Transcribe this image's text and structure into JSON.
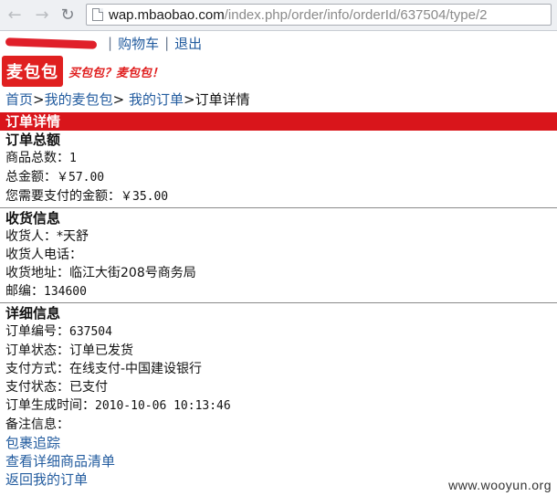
{
  "browser": {
    "url_host": "wap.mbaobao.com",
    "url_path": "/index.php/order/info/orderId/637504/type/2"
  },
  "userbar": {
    "cart_label": "购物车",
    "logout_label": "退出",
    "separator": "|"
  },
  "brand": {
    "logo_text": "麦包包",
    "slogan": "买包包？麦包包！",
    "accent_color": "#d9151b"
  },
  "breadcrumb": {
    "home": "首页",
    "my_bag": "我的麦包包",
    "my_orders": "我的订单",
    "current": "订单详情",
    "sep": ">"
  },
  "page_title": "订单详情",
  "order_total": {
    "heading": "订单总额",
    "item_count_label": "商品总数：",
    "item_count": "1",
    "total_label": "总金额：",
    "total": "￥57.00",
    "due_label": "您需要支付的金额：",
    "due": "￥35.00"
  },
  "shipping": {
    "heading": "收货信息",
    "receiver_label": "收货人：",
    "receiver": "*天舒",
    "phone_label": "收货人电话：",
    "phone": "",
    "address_label": "收货地址：",
    "address": "临江大街208号商务局",
    "zip_label": "邮编：",
    "zip": "134600"
  },
  "details": {
    "heading": "详细信息",
    "order_no_label": "订单编号：",
    "order_no": "637504",
    "status_label": "订单状态：",
    "status": "订单已发货",
    "pay_method_label": "支付方式：",
    "pay_method": "在线支付-中国建设银行",
    "pay_status_label": "支付状态：",
    "pay_status": "已支付",
    "created_label": "订单生成时间：",
    "created": "2010-10-06 10:13:46",
    "note_label": "备注信息："
  },
  "links": {
    "track": "包裹追踪",
    "item_list": "查看详细商品清单",
    "back": "返回我的订单"
  },
  "watermark": "www.wooyun.org"
}
